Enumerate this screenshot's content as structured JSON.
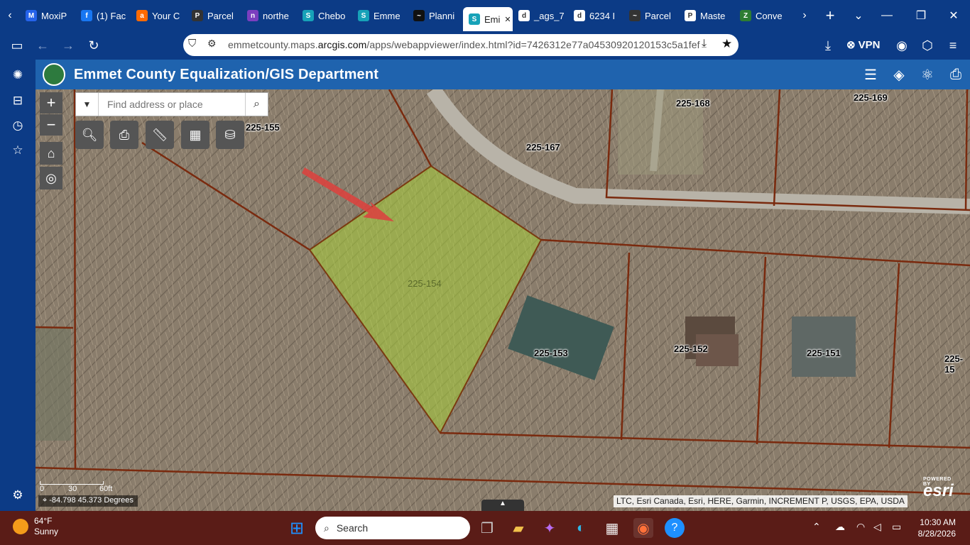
{
  "browser": {
    "tabs": [
      {
        "label": "MoxiP",
        "fav_color": "#2563eb",
        "fav": "M"
      },
      {
        "label": "(1) Fac",
        "fav_color": "#1877f2",
        "fav": "f"
      },
      {
        "label": "Your C",
        "fav_color": "#ff6a00",
        "fav": "a"
      },
      {
        "label": "Parcel",
        "fav_color": "#333333",
        "fav": "P"
      },
      {
        "label": "northe",
        "fav_color": "#7b3fbf",
        "fav": "n"
      },
      {
        "label": "Chebo",
        "fav_color": "#17a2b8",
        "fav": "S"
      },
      {
        "label": "Emme",
        "fav_color": "#17a2b8",
        "fav": "S"
      },
      {
        "label": "Planni",
        "fav_color": "#111111",
        "fav": "~"
      },
      {
        "label": "Emi",
        "fav_color": "#17a2b8",
        "fav": "S",
        "active": true
      },
      {
        "label": "_ags_7",
        "fav_color": "#ffffff",
        "fav": "d"
      },
      {
        "label": "6234 I",
        "fav_color": "#ffffff",
        "fav": "d"
      },
      {
        "label": "Parcel",
        "fav_color": "#333333",
        "fav": "~"
      },
      {
        "label": "Maste",
        "fav_color": "#ffffff",
        "fav": "P"
      },
      {
        "label": "Conve",
        "fav_color": "#2e7d32",
        "fav": "Z"
      }
    ],
    "url_prefix": "emmetcounty.maps.",
    "url_domain": "arcgis.com",
    "url_suffix": "/apps/webappviewer/index.html?id=7426312e77a04530920120153c5a1fef",
    "vpn_label": "VPN"
  },
  "app": {
    "title": "Emmet County Equalization/GIS Department"
  },
  "search": {
    "placeholder": "Find address or place"
  },
  "map": {
    "parcels": [
      {
        "id": "225-155"
      },
      {
        "id": "225-167"
      },
      {
        "id": "225-168"
      },
      {
        "id": "225-169"
      },
      {
        "id": "225-154"
      },
      {
        "id": "225-153"
      },
      {
        "id": "225-152"
      },
      {
        "id": "225-151"
      },
      {
        "id": "225-15"
      }
    ],
    "scale_labels": [
      "0",
      "30",
      "60ft"
    ],
    "coordinates": "-84.798 45.373 Degrees",
    "attribution": "LTC, Esri Canada, Esri, HERE, Garmin, INCREMENT P, USGS, EPA, USDA",
    "esri_powered": "POWERED BY",
    "esri_logo": "esri"
  },
  "taskbar": {
    "temp": "64°F",
    "condition": "Sunny",
    "search_label": "Search",
    "time": "10:30 AM",
    "date": "8/28/2026"
  }
}
